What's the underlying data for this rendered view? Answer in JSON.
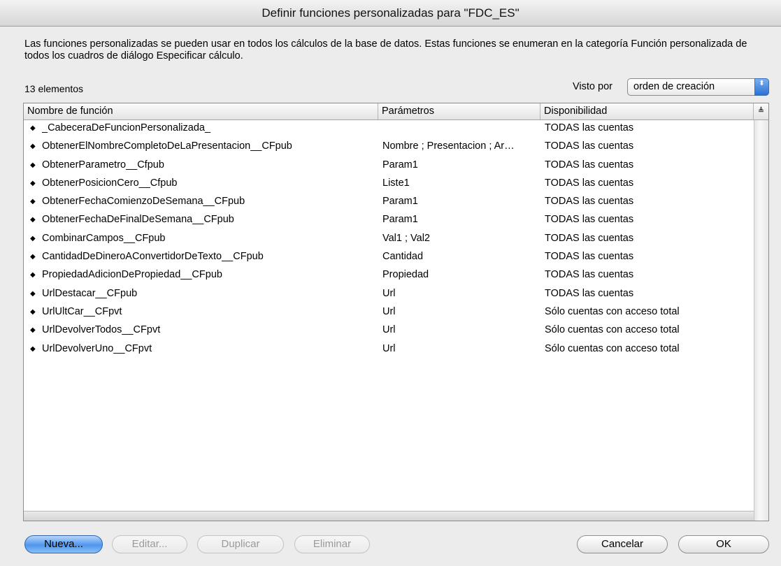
{
  "window": {
    "title": "Definir funciones personalizadas para \"FDC_ES\""
  },
  "description": "Las funciones personalizadas se pueden usar en todos los cálculos de la base de datos. Estas funciones se enumeran en la categoría Función personalizada de todos los cuadros de diálogo Especificar cálculo.",
  "count_label": "13 elementos",
  "view": {
    "label": "Visto por",
    "selected": "orden de creación",
    "arrow_glyph": "⬍"
  },
  "table": {
    "headers": [
      "Nombre de función",
      "Parámetros",
      "Disponibilidad"
    ],
    "sort_glyph": "≜",
    "row_handle_glyph": "◆",
    "rows": [
      {
        "name": "_CabeceraDeFuncionPersonalizada_",
        "params": "",
        "availability": "TODAS las cuentas"
      },
      {
        "name": "ObtenerElNombreCompletoDeLaPresentacion__CFpub",
        "params": "Nombre ; Presentacion ; Ar…",
        "availability": "TODAS las cuentas"
      },
      {
        "name": "ObtenerParametro__Cfpub",
        "params": "Param1",
        "availability": "TODAS las cuentas"
      },
      {
        "name": "ObtenerPosicionCero__Cfpub",
        "params": "Liste1",
        "availability": "TODAS las cuentas"
      },
      {
        "name": "ObtenerFechaComienzoDeSemana__CFpub",
        "params": "Param1",
        "availability": "TODAS las cuentas"
      },
      {
        "name": "ObtenerFechaDeFinalDeSemana__CFpub",
        "params": "Param1",
        "availability": "TODAS las cuentas"
      },
      {
        "name": "CombinarCampos__CFpub",
        "params": "Val1 ; Val2",
        "availability": "TODAS las cuentas"
      },
      {
        "name": "CantidadDeDineroAConvertidorDeTexto__CFpub",
        "params": "Cantidad",
        "availability": "TODAS las cuentas"
      },
      {
        "name": "PropiedadAdicionDePropiedad__CFpub",
        "params": "Propiedad",
        "availability": "TODAS las cuentas"
      },
      {
        "name": "UrlDestacar__CFpub",
        "params": "Url",
        "availability": "TODAS las cuentas"
      },
      {
        "name": "UrlUltCar__CFpvt",
        "params": "Url",
        "availability": "Sólo cuentas con acceso total"
      },
      {
        "name": "UrlDevolverTodos__CFpvt",
        "params": "Url",
        "availability": "Sólo cuentas con acceso total"
      },
      {
        "name": "UrlDevolverUno__CFpvt",
        "params": "Url",
        "availability": "Sólo cuentas con acceso total"
      }
    ]
  },
  "buttons": {
    "new": "Nueva...",
    "edit": "Editar...",
    "duplicate": "Duplicar",
    "delete": "Eliminar",
    "cancel": "Cancelar",
    "ok": "OK"
  }
}
